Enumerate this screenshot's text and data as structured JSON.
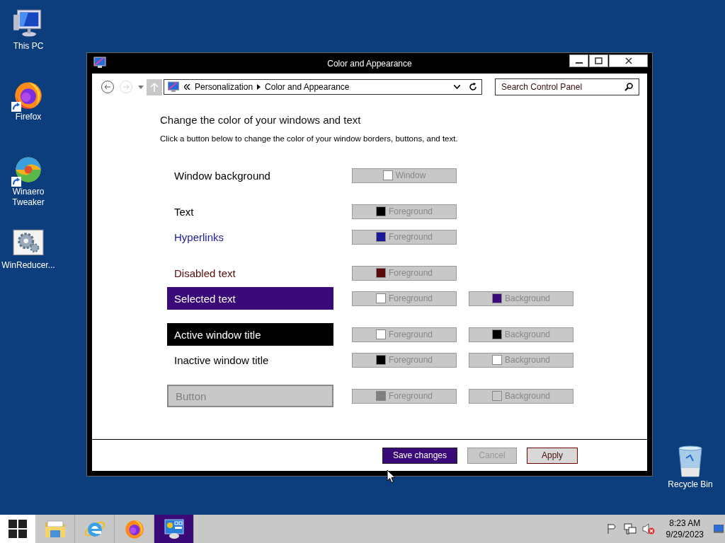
{
  "desktop_icons": [
    {
      "kind": "computer",
      "label": "This PC",
      "shortcut": false
    },
    {
      "kind": "firefox",
      "label": "Firefox",
      "shortcut": true
    },
    {
      "kind": "tweaker",
      "label": "Winaero Tweaker",
      "shortcut": true
    },
    {
      "kind": "gears",
      "label": "WinReducer...",
      "shortcut": false
    }
  ],
  "recycle_bin": {
    "label": "Recycle Bin"
  },
  "window": {
    "title": "Color and Appearance",
    "address": {
      "breadcrumbs": [
        "Personalization",
        "Color and Appearance"
      ]
    },
    "search": {
      "placeholder": "Search Control Panel"
    },
    "heading": "Change the color of your windows and text",
    "description": "Click a button below to change the color of your window borders, buttons, and text.",
    "groups": [
      {
        "rows": [
          {
            "label": "Window background",
            "kind": "plain",
            "swatches": [
              {
                "label": "Window",
                "color": "#ffffff"
              }
            ]
          }
        ]
      },
      {
        "rows": [
          {
            "label": "Text",
            "kind": "plain",
            "swatches": [
              {
                "label": "Foreground",
                "kind": "foreground",
                "color": "#000000"
              }
            ]
          },
          {
            "label": "Hyperlinks",
            "kind": "plain",
            "swatches": [
              {
                "label": "Foreground",
                "kind": "foreground",
                "color": "#1a1a99"
              }
            ]
          }
        ]
      },
      {
        "rows": [
          {
            "label": "Disabled text",
            "kind": "plain",
            "swatches": [
              {
                "label": "Foreground",
                "kind": "foreground",
                "color": "#5a0a0a"
              }
            ]
          },
          {
            "label": "Selected text",
            "kind": "filled",
            "swatches": [
              {
                "label": "Foreground",
                "kind": "foreground",
                "color": "#ffffff"
              },
              {
                "label": "Background",
                "kind": "background",
                "color": "#3a0a78"
              }
            ]
          }
        ]
      },
      {
        "rows": [
          {
            "label": "Active window title",
            "kind": "filled",
            "swatches": [
              {
                "label": "Foreground",
                "kind": "foreground",
                "color": "#ffffff"
              },
              {
                "label": "Background",
                "kind": "background",
                "color": "#000000"
              }
            ]
          },
          {
            "label": "Inactive window title",
            "kind": "plain",
            "swatches": [
              {
                "label": "Foreground",
                "kind": "foreground",
                "color": "#000000"
              },
              {
                "label": "Background",
                "kind": "background",
                "color": "#ffffff"
              }
            ]
          }
        ]
      },
      {
        "rows": [
          {
            "label": "Button",
            "kind": "button",
            "swatches": [
              {
                "label": "Foreground",
                "kind": "foreground",
                "color": "#808080"
              },
              {
                "label": "Background",
                "kind": "background",
                "color": "#c8c8c8"
              }
            ]
          }
        ]
      }
    ],
    "buttons": [
      {
        "label": "Save changes",
        "kind": "primary"
      },
      {
        "label": "Cancel",
        "kind": "disabled"
      },
      {
        "label": "Apply",
        "kind": "normal"
      }
    ]
  },
  "taskbar": {
    "apps": [
      {
        "kind": "explorer",
        "selected": false
      },
      {
        "kind": "ie",
        "selected": false
      },
      {
        "kind": "firefox",
        "selected": false
      },
      {
        "kind": "control-panel",
        "selected": true
      }
    ],
    "time": "8:23 AM",
    "date": "9/29/2023"
  }
}
